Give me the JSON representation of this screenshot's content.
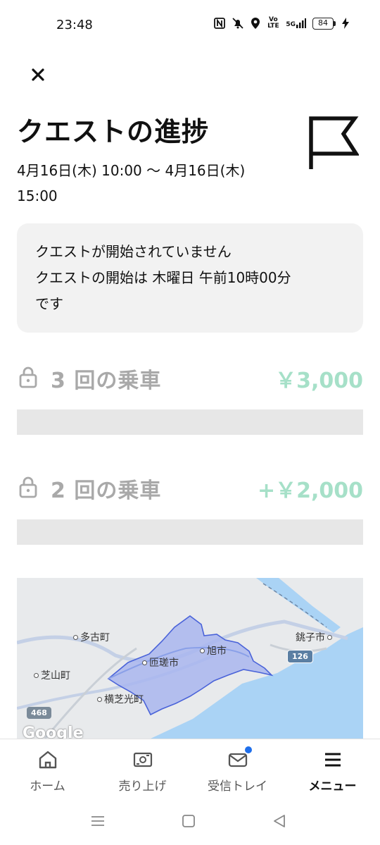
{
  "status_bar": {
    "time": "23:48",
    "network_label": "5G",
    "volte_label": "Vo LTE",
    "battery": "84",
    "icons": [
      "nfc-icon",
      "mute-icon",
      "location-icon",
      "volte-icon",
      "signal-icon",
      "battery-icon",
      "charging-icon"
    ]
  },
  "header": {
    "close_icon": "close-icon",
    "title": "クエストの進捗",
    "flag_icon": "flag-icon",
    "date_range": "4月16日(木) 10:00 〜 4月16日(木) 15:00"
  },
  "notice": {
    "line1": "クエストが開始されていません",
    "line2": "クエストの開始は 木曜日 午前10時00分",
    "line3": "です"
  },
  "tiers": [
    {
      "label": "3 回の乗車",
      "reward": "￥3,000",
      "locked": true,
      "progress": 0
    },
    {
      "label": "2 回の乗車",
      "reward": "+￥2,000",
      "locked": true,
      "progress": 0
    }
  ],
  "map": {
    "places": {
      "tako": "多古町",
      "shibayama": "芝山町",
      "sosa": "匝瑳市",
      "asahi": "旭市",
      "yokoshibahikari": "横芝光町",
      "choshi": "銚子市"
    },
    "routes": {
      "r126": "126",
      "r468": "468"
    },
    "attribution": "Google",
    "colors": {
      "land": "#e8eaec",
      "sea": "#aad3f5",
      "zone_fill": "#a9b6ef",
      "zone_stroke": "#4a63d9"
    }
  },
  "bottom_nav": {
    "items": [
      {
        "label": "ホーム",
        "icon": "home-icon",
        "active": false
      },
      {
        "label": "売り上げ",
        "icon": "earnings-icon",
        "active": false
      },
      {
        "label": "受信トレイ",
        "icon": "inbox-icon",
        "active": false,
        "has_notification": true
      },
      {
        "label": "メニュー",
        "icon": "menu-icon",
        "active": true
      }
    ]
  },
  "system_nav": {
    "icons": [
      "recent-apps-icon",
      "home-system-icon",
      "back-icon"
    ]
  }
}
